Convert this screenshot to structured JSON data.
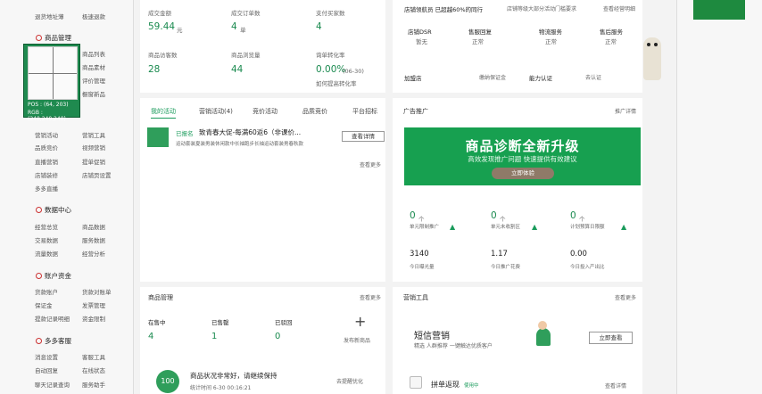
{
  "sidebar": {
    "top_links": [
      "退货地址薄",
      "极速退款"
    ],
    "product_mgmt": {
      "title": "商品管理",
      "items": [
        "商品列表",
        "商品素材",
        "评价管理",
        "橱窗新品"
      ]
    },
    "pixel_info": {
      "pos": "POS : (64, 203)",
      "rgb": "RGB : (240,240,240)"
    },
    "marketing_items": [
      "营销活动",
      "营销工具",
      "品质竞价",
      "视频营销",
      "直播营销",
      "提单促销",
      "店铺装修",
      "店铺页设置",
      "多多直播"
    ],
    "data_center": {
      "title": "数据中心",
      "items": [
        "经营总览",
        "商品数据",
        "交易数据",
        "服务数据",
        "流量数据",
        "经营分析"
      ]
    },
    "account_funds": {
      "title": "账户资金",
      "items": [
        "货款账户",
        "货款对账单",
        "保证金",
        "发票管理",
        "提款记录明细",
        "资金限制"
      ]
    },
    "duoduo_customer": {
      "title": "多多客服",
      "items": [
        "消息设置",
        "客服工具",
        "自动回复",
        "在线状态",
        "聊天记录查询",
        "服务助手"
      ]
    }
  },
  "stats": {
    "items": [
      {
        "label": "成交金额",
        "value": "59.44",
        "unit": "元"
      },
      {
        "label": "成交订单数",
        "value": "4",
        "unit": "单"
      },
      {
        "label": "支付买家数",
        "value": "4",
        "unit": ""
      },
      {
        "label": "商品访客数",
        "value": "28",
        "unit": ""
      },
      {
        "label": "商品浏览量",
        "value": "44",
        "unit": ""
      },
      {
        "label": "询单转化率",
        "value": "0.00%",
        "unit": "(06-30)",
        "sub": "如何提高转化率"
      }
    ]
  },
  "store": {
    "rank_text": "店铺领航员  已超越60%的同行",
    "rank_link": "店铺等级大部分活动门槛要求",
    "detail_link": "查看经营明细",
    "metrics": [
      {
        "label": "店铺DSR",
        "value": "暂无"
      },
      {
        "label": "售服回复",
        "value": "正常"
      },
      {
        "label": "物流服务",
        "value": "正常"
      },
      {
        "label": "售后服务",
        "value": "正常"
      }
    ],
    "shop_info": "加盟店",
    "bond_link": "缴纳保证金",
    "cert_label": "能力认证",
    "cert_link": "去认证"
  },
  "activities": {
    "tabs": [
      "我的活动",
      "营销活动(4)",
      "竞价活动",
      "品质竞价",
      "平台招标"
    ],
    "item_status": "已报名",
    "item_title": "致青春大促-每满60返6（非课价...",
    "item_desc": "运动套装夏装男装休闲款中长袖跑步长袖运动套装男春秋款",
    "detail_button": "查看详情",
    "more": "查看更多"
  },
  "ad": {
    "title": "广告推广",
    "link": "推广详情",
    "banner_title": "商品诊断全新升级",
    "banner_sub": "高效发现推广问题 快速提供有效建议",
    "banner_button": "立即体验",
    "stats": [
      {
        "value": "0",
        "unit": "个",
        "label": "单元限制推广"
      },
      {
        "value": "0",
        "unit": "个",
        "label": "单元未收割区"
      },
      {
        "value": "0",
        "unit": "个",
        "label": "计划预算日限额"
      }
    ],
    "stats2": [
      {
        "value": "3140",
        "label": "今日曝光量"
      },
      {
        "value": "1.17",
        "label": "今日推广花费"
      },
      {
        "value": "0.00",
        "label": "今日投入产出比"
      }
    ]
  },
  "products": {
    "title": "商品管理",
    "more": "查看更多",
    "counts": [
      {
        "label": "在售中",
        "value": "4"
      },
      {
        "label": "已售罄",
        "value": "1"
      },
      {
        "label": "已驳回",
        "value": "0"
      }
    ],
    "publish": "发布新商品",
    "health_score": "100",
    "health_text": "商品状况非常好，请继续保持",
    "health_time": "统计时间 6-30 00:16:21",
    "health_link": "去提醒优化"
  },
  "marketing_tools": {
    "title": "营销工具",
    "more": "查看更多",
    "sms_title": "短信营销",
    "sms_sub": "精选 人群推荐 一键触达优质客户",
    "sms_button": "立即查看",
    "coupon_title": "拼单返现",
    "coupon_badge": "使用中",
    "coupon_link": "查看详情"
  }
}
